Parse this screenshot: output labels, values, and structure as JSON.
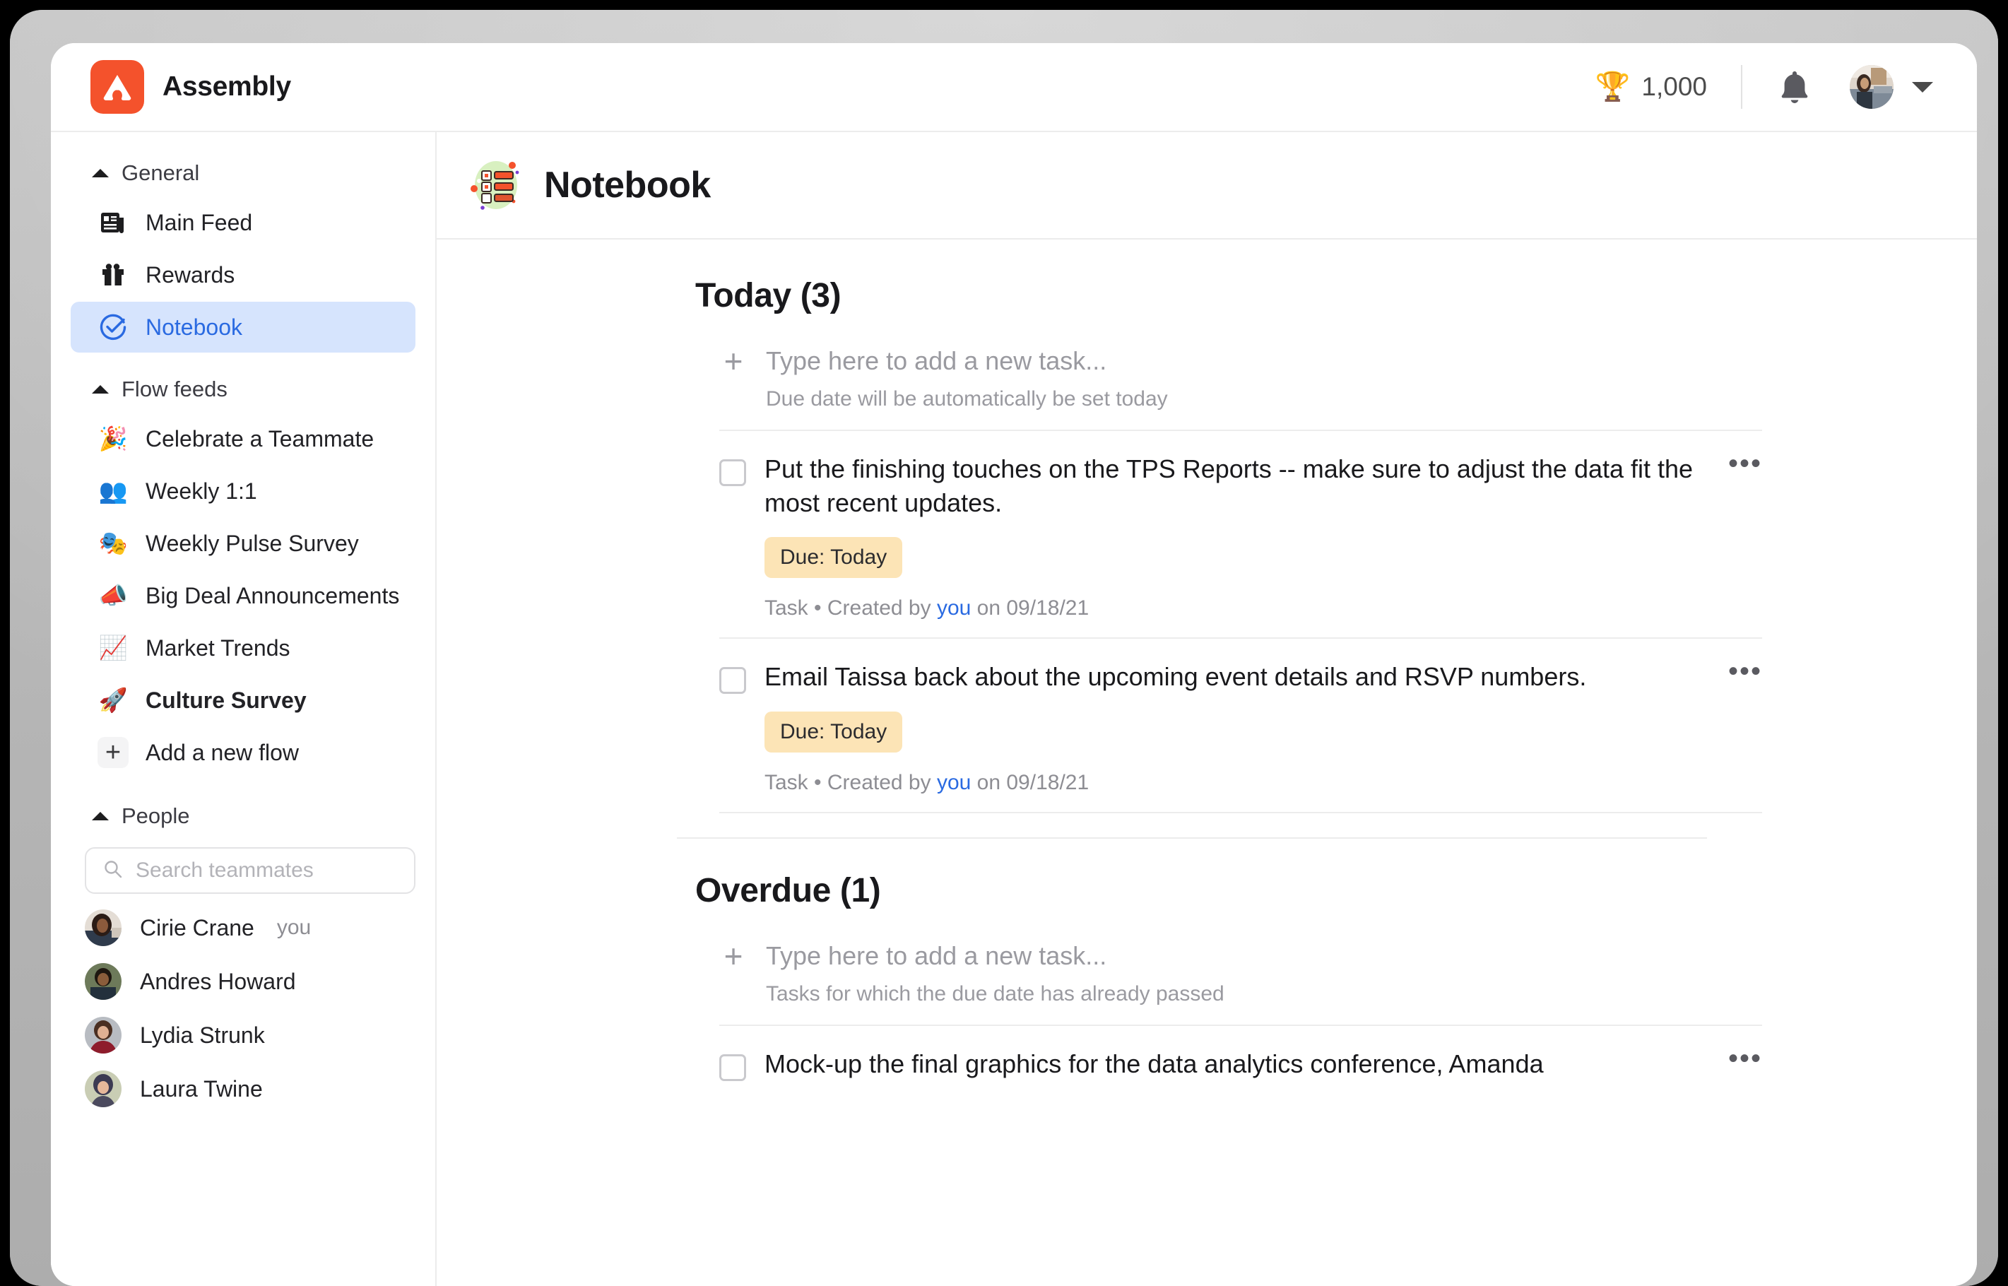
{
  "window": {
    "frame_color": "#b9b9b9"
  },
  "header": {
    "brand_name": "Assembly",
    "brand_logo_icon": "assembly-logo-icon",
    "points_icon": "trophy-icon",
    "points": "1,000",
    "notifications_icon": "bell-icon",
    "avatar_icon": "user-avatar",
    "account_caret_icon": "chevron-down-icon"
  },
  "sidebar": {
    "sections": [
      {
        "label": "General",
        "collapse_icon": "triangle-up-icon",
        "items": [
          {
            "label": "Main Feed",
            "icon": "news-feed-icon",
            "selected": false,
            "bold": false
          },
          {
            "label": "Rewards",
            "icon": "gift-icon",
            "selected": false,
            "bold": false
          },
          {
            "label": "Notebook",
            "icon": "check-circle-icon",
            "selected": true,
            "bold": false
          }
        ]
      },
      {
        "label": "Flow feeds",
        "collapse_icon": "triangle-up-icon",
        "items": [
          {
            "label": "Celebrate a Teammate",
            "emoji": "🎉",
            "icon": "party-popper-icon",
            "selected": false,
            "bold": false
          },
          {
            "label": "Weekly 1:1",
            "emoji": "👥",
            "icon": "two-people-icon",
            "selected": false,
            "bold": false
          },
          {
            "label": "Weekly Pulse Survey",
            "emoji": "🎭",
            "icon": "performing-arts-icon",
            "selected": false,
            "bold": false
          },
          {
            "label": "Big Deal Announcements",
            "emoji": "📣",
            "icon": "megaphone-icon",
            "selected": false,
            "bold": false
          },
          {
            "label": "Market Trends",
            "emoji": "📈",
            "icon": "chart-increasing-icon",
            "selected": false,
            "bold": false
          },
          {
            "label": "Culture Survey",
            "emoji": "🚀",
            "icon": "rocket-icon",
            "selected": false,
            "bold": true
          },
          {
            "label": "Add a new flow",
            "icon": "plus-icon",
            "selected": false,
            "bold": false
          }
        ]
      },
      {
        "label": "People",
        "collapse_icon": "triangle-up-icon",
        "search": {
          "icon": "search-icon",
          "placeholder": "Search teammates",
          "value": ""
        },
        "people": [
          {
            "name": "Cirie Crane",
            "tag": "you",
            "avatar_icon": "avatar-cirie-crane"
          },
          {
            "name": "Andres Howard",
            "tag": "",
            "avatar_icon": "avatar-andres-howard"
          },
          {
            "name": "Lydia Strunk",
            "tag": "",
            "avatar_icon": "avatar-lydia-strunk"
          },
          {
            "name": "Laura Twine",
            "tag": "",
            "avatar_icon": "avatar-laura-twine"
          }
        ]
      }
    ]
  },
  "main": {
    "page_icon": "notebook-checklist-icon",
    "page_title": "Notebook",
    "sections": [
      {
        "heading": "Today (3)",
        "add_task": {
          "plus_icon": "plus-icon",
          "placeholder": "Type here to add a new task...",
          "hint": "Due date will be automatically be set today"
        },
        "tasks": [
          {
            "checkbox_icon": "checkbox-unchecked-icon",
            "text": "Put the finishing touches on the TPS Reports -- make sure to adjust the data fit the most recent updates.",
            "badge": "Due: Today",
            "badge_color": "#fce4b6",
            "meta_prefix": "Task • Created by ",
            "meta_author": "you",
            "meta_suffix": " on 09/18/21",
            "menu_icon": "ellipsis-horizontal-icon"
          },
          {
            "checkbox_icon": "checkbox-unchecked-icon",
            "text": "Email Taissa back about the upcoming event details and RSVP numbers.",
            "badge": "Due: Today",
            "badge_color": "#fce4b6",
            "meta_prefix": "Task • Created by ",
            "meta_author": "you",
            "meta_suffix": " on 09/18/21",
            "menu_icon": "ellipsis-horizontal-icon"
          }
        ]
      },
      {
        "heading": "Overdue (1)",
        "add_task": {
          "plus_icon": "plus-icon",
          "placeholder": "Type here to add a new task...",
          "hint": "Tasks for which the due date has already passed"
        },
        "tasks": [
          {
            "checkbox_icon": "checkbox-unchecked-icon",
            "text": "Mock-up the final graphics for the data analytics conference, Amanda",
            "badge": "",
            "badge_color": "",
            "meta_prefix": "",
            "meta_author": "",
            "meta_suffix": "",
            "menu_icon": "ellipsis-horizontal-icon"
          }
        ]
      }
    ]
  },
  "colors": {
    "brand_orange": "#f4522c",
    "accent_blue": "#2a6ae1",
    "selected_bg": "#d6e4fd",
    "due_badge_bg": "#fce4b6",
    "muted_text": "#8d8d93",
    "divider": "#ececec"
  }
}
